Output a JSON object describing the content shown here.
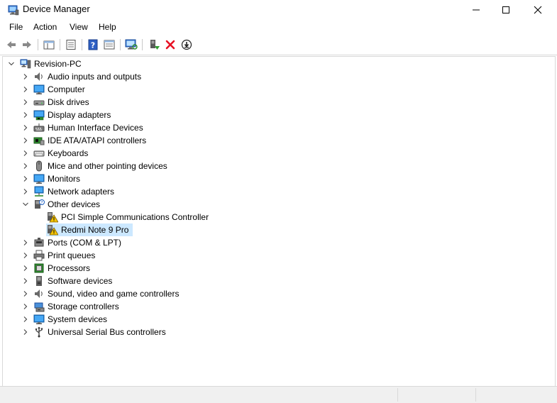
{
  "window": {
    "title": "Device Manager"
  },
  "menu": [
    "File",
    "Action",
    "View",
    "Help"
  ],
  "toolbar": {
    "buttons": [
      "back-icon",
      "forward-icon",
      "show-hide-console-tree-icon",
      "properties-icon",
      "help-icon",
      "view-icon",
      "scan-hardware-changes-icon",
      "enable-device-icon",
      "uninstall-device-icon",
      "update-driver-icon"
    ]
  },
  "colors": {
    "selection": "#cce8ff",
    "warning": "#f5c400",
    "uninstall": "#e81123"
  },
  "tree": {
    "root": "Revision-PC",
    "categories": [
      {
        "label": "Audio inputs and outputs",
        "icon": "speaker-icon"
      },
      {
        "label": "Computer",
        "icon": "computer-icon"
      },
      {
        "label": "Disk drives",
        "icon": "disk-drive-icon"
      },
      {
        "label": "Display adapters",
        "icon": "display-adapter-icon"
      },
      {
        "label": "Human Interface Devices",
        "icon": "hid-icon"
      },
      {
        "label": "IDE ATA/ATAPI controllers",
        "icon": "ide-controller-icon"
      },
      {
        "label": "Keyboards",
        "icon": "keyboard-icon"
      },
      {
        "label": "Mice and other pointing devices",
        "icon": "mouse-icon"
      },
      {
        "label": "Monitors",
        "icon": "monitor-icon"
      },
      {
        "label": "Network adapters",
        "icon": "network-adapter-icon"
      },
      {
        "label": "Other devices",
        "icon": "unknown-device-icon",
        "expanded": true,
        "children": [
          {
            "label": "PCI Simple Communications Controller",
            "icon": "warning-device-icon"
          },
          {
            "label": "Redmi Note 9 Pro",
            "icon": "warning-device-icon",
            "selected": true
          }
        ]
      },
      {
        "label": "Ports (COM & LPT)",
        "icon": "port-icon"
      },
      {
        "label": "Print queues",
        "icon": "printer-icon"
      },
      {
        "label": "Processors",
        "icon": "processor-icon"
      },
      {
        "label": "Software devices",
        "icon": "software-device-icon"
      },
      {
        "label": "Sound, video and game controllers",
        "icon": "sound-controller-icon"
      },
      {
        "label": "Storage controllers",
        "icon": "storage-controller-icon"
      },
      {
        "label": "System devices",
        "icon": "system-device-icon"
      },
      {
        "label": "Universal Serial Bus controllers",
        "icon": "usb-icon"
      }
    ]
  }
}
